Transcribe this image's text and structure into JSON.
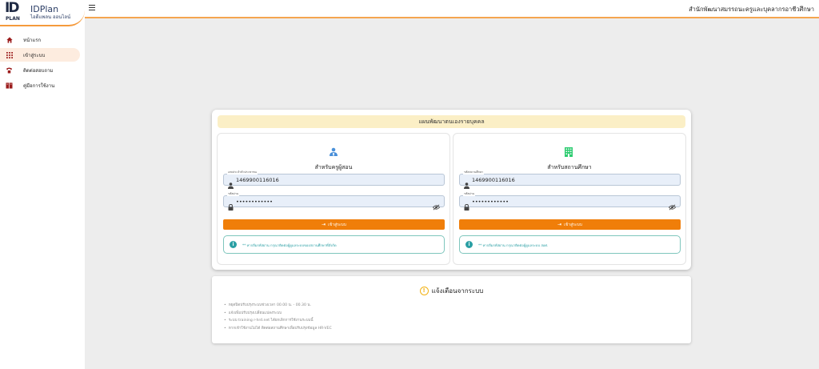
{
  "brand": {
    "logo_big": "ID",
    "logo_small": "PLAN",
    "title": "IDPlan",
    "subtitle": "ไอดีแพลน ออนไลน์"
  },
  "sidebar": {
    "items": [
      {
        "label": "หน้าแรก",
        "icon": "home-icon",
        "active": false
      },
      {
        "label": "เข้าสู่ระบบ",
        "icon": "grid-icon",
        "active": true
      },
      {
        "label": "ติดต่อสอบถาม",
        "icon": "phone-icon",
        "active": false
      },
      {
        "label": "คู่มือการใช้งาน",
        "icon": "book-icon",
        "active": false
      }
    ]
  },
  "header": {
    "org_name": "สำนักพัฒนาสมรรถนะครูและบุคลากรอาชีวศึกษา"
  },
  "login": {
    "title": "แผนพัฒนาตนเองรายบุคคล",
    "teacher": {
      "title": "สำหรับครูผู้สอน",
      "username_label": "เลขประจำตัวประชาชน",
      "username_value": "1469900116016",
      "password_label": "รหัสผ่าน",
      "password_value": "••••••••••••",
      "button_label": "เข้าสู่ระบบ",
      "info": "** หากลืมรหัสผ่าน กรุณาติดต่อผู้ดูแลระบบของสถานศึกษาที่สังกัด"
    },
    "school": {
      "title": "สำหรับสถานศึกษา",
      "username_label": "รหัสสถานศึกษา",
      "username_value": "1469900116016",
      "password_label": "รหัสผ่าน",
      "password_value": "••••••••••••",
      "button_label": "เข้าสู่ระบบ",
      "info": "** หากลืมรหัสผ่าน กรุณาติดต่อผู้ดูแลระบบ สอศ."
    }
  },
  "notice": {
    "title": "แจ้งเตือนจากระบบ",
    "items": [
      "หยุดปิดปรับปรุงระบบช่วงเวลา 00.00 น. - 00.30 น.",
      "แจ้งเพิ่มปรับปรุงเปลี่ยนแปลงระบบ",
      "ระบบ training r-hrd.net ได้ยกเลิกการใช้งานระบบนี้",
      "หากเข้าใช้งานไม่ได้ ติดต่อสถานศึกษาเพื่อปรับปรุงข้อมูล HR-VEC"
    ]
  },
  "colors": {
    "accent": "#f07e09",
    "info": "#2a9fa4",
    "header_banner": "#fbefc6",
    "teacher_icon": "#4a90d9",
    "school_icon": "#2ecc71"
  }
}
